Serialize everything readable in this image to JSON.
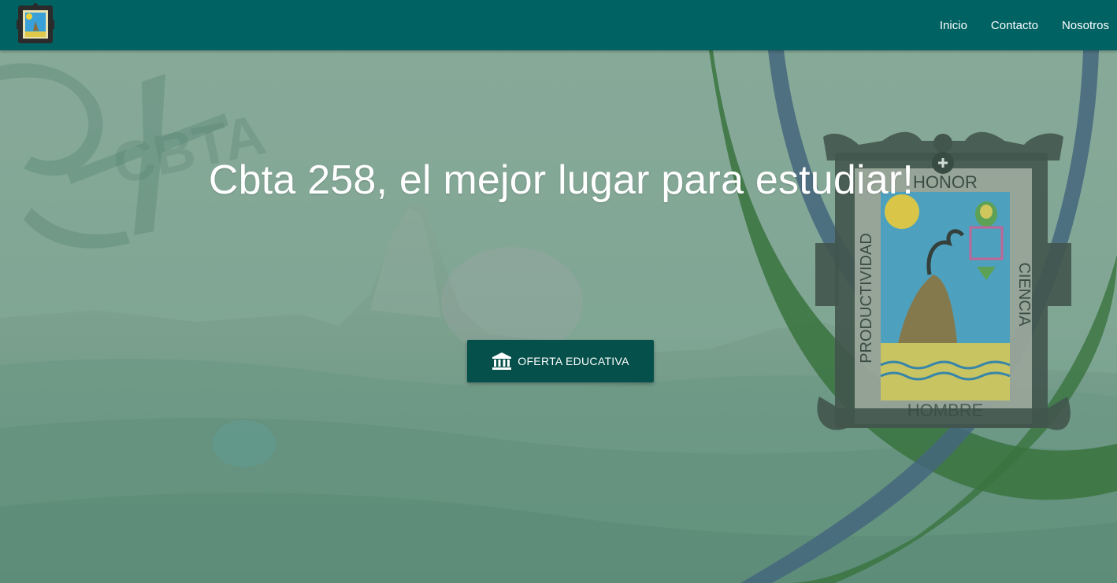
{
  "navbar": {
    "logo_icon": "school-crest-icon",
    "links": [
      {
        "label": "Inicio"
      },
      {
        "label": "Contacto"
      },
      {
        "label": "Nosotros"
      }
    ]
  },
  "hero": {
    "title": "Cbta 258, el mejor lugar para estudiar!",
    "cta": {
      "label": "OFERTA EDUCATIVA",
      "icon": "institution-icon"
    },
    "crest": {
      "top_word": "HONOR",
      "left_word": "PRODUCTIVIDAD",
      "right_word": "CIENCIA",
      "bottom_word": "HOMBRE"
    },
    "watermark_logo": {
      "text": "CBTA"
    }
  },
  "colors": {
    "navbar": "#006262",
    "button": "#05504a",
    "overlay": "#6a9e8a"
  }
}
